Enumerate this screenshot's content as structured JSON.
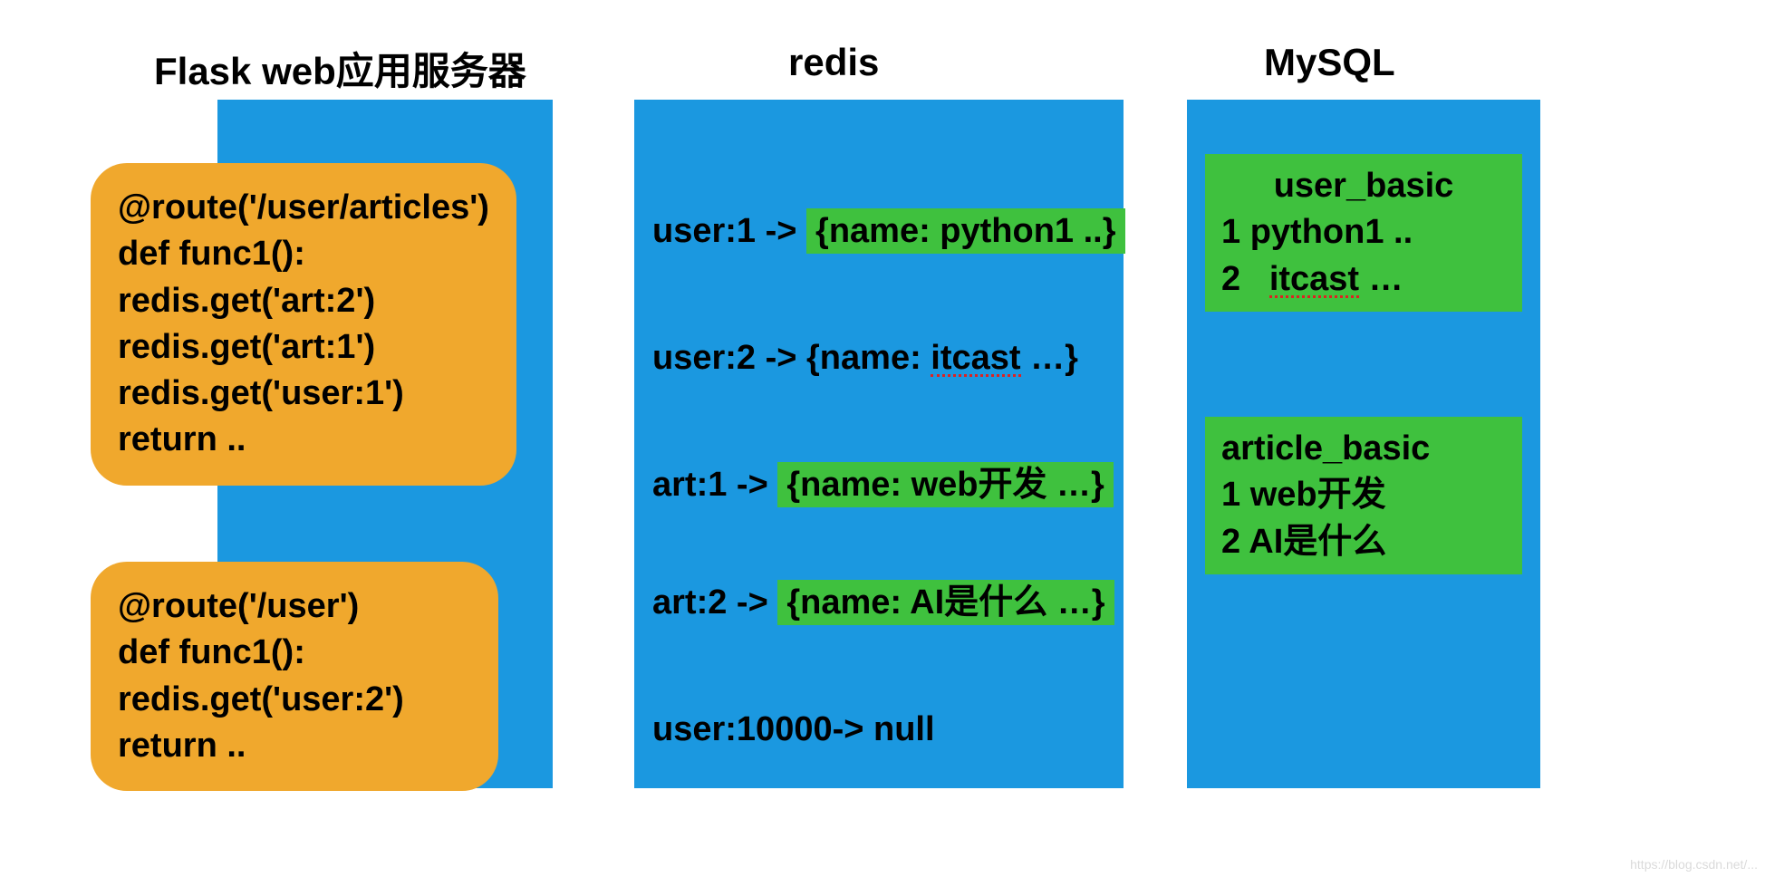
{
  "titles": {
    "flask": "Flask web应用服务器",
    "redis": "redis",
    "mysql": "MySQL"
  },
  "flask": {
    "box1": {
      "l1": "@route('/user/articles')",
      "l2": "def func1():",
      "l3": "   redis.get('art:2')",
      "l4": "    redis.get('art:1')",
      "l5": "    redis.get('user:1')",
      "l6": "   return .."
    },
    "box2": {
      "l1": "@route('/user')",
      "l2": "def func1():",
      "l3": "    redis.get('user:2')",
      "l4": "    return .."
    }
  },
  "redis": {
    "r1_pre": "user:1 -> ",
    "r1_hl": "{name: python1 ..}",
    "r2_pre": "user:2 ->  {name: ",
    "r2_hl": "itcast",
    "r2_post": " …}",
    "r3_pre": "art:1 ->  ",
    "r3_hl": "{name: web开发 …}",
    "r4_pre": "art:2 ->  ",
    "r4_hl": "{name: AI是什么 …}",
    "r5": "user:10000-> null"
  },
  "mysql": {
    "t1": {
      "name": "user_basic",
      "r1": "1   python1 ..",
      "r2": "2   itcast …"
    },
    "t2": {
      "name": "article_basic",
      "r1": "1   web开发",
      "r2": "2   AI是什么"
    }
  },
  "watermark": "https://blog.csdn.net/..."
}
